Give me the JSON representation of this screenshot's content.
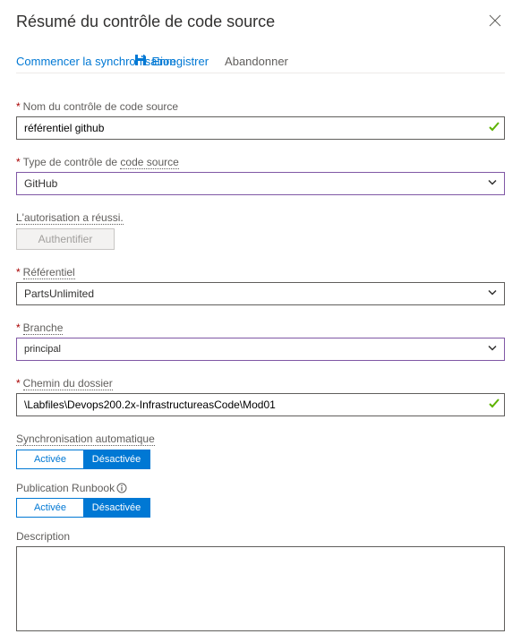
{
  "header": {
    "title": "Résumé du contrôle de code source"
  },
  "toolbar": {
    "sync_label": "Commencer la synchronisation",
    "save_label": "Enregistrer",
    "discard_label": "Abandonner"
  },
  "fields": {
    "name": {
      "label": "Nom du contrôle de code source",
      "value": "référentiel github"
    },
    "type": {
      "label_prefix": "Type de contrôle de ",
      "label_link": "code source",
      "value": "GitHub"
    },
    "auth": {
      "success_text": "L'autorisation a réussi.",
      "button_label": "Authentifier"
    },
    "repo": {
      "label": "Référentiel",
      "value": "PartsUnlimited"
    },
    "branch": {
      "label": "Branche",
      "value": "principal"
    },
    "folder": {
      "label": "Chemin du dossier",
      "value": "\\Labfiles\\Devops200.2x-InfrastructureasCode\\Mod01"
    },
    "autosync": {
      "label": "Synchronisation automatique",
      "on": "Activée",
      "off": "Désactivée"
    },
    "publish": {
      "label": "Publication Runbook",
      "on": "Activée",
      "off": "Désactivée"
    },
    "description": {
      "label": "Description",
      "value": ""
    }
  }
}
